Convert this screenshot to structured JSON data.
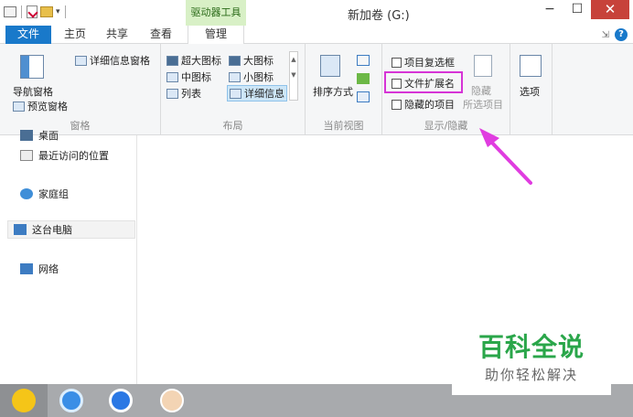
{
  "window": {
    "title": "新加卷 (G:)",
    "context_group_label": "驱动器工具",
    "minimize": "−",
    "maximize": "☐",
    "close": "✕"
  },
  "tabs": {
    "file": "文件",
    "home": "主页",
    "share": "共享",
    "view": "查看",
    "manage": "管理"
  },
  "ribbon": {
    "panes": {
      "nav_pane": "导航窗格",
      "preview_pane": "预览窗格",
      "details_pane": "详细信息窗格",
      "label": "窗格"
    },
    "layout": {
      "extra_large_icons": "超大图标",
      "large_icons": "大图标",
      "medium_icons": "中图标",
      "small_icons": "小图标",
      "list": "列表",
      "details": "详细信息",
      "label": "布局"
    },
    "current_view": {
      "sort_by": "排序方式",
      "label": "当前视图"
    },
    "show_hide": {
      "item_checkboxes": "项目复选框",
      "file_extensions": "文件扩展名",
      "hidden_items": "隐藏的项目",
      "hide_selected_line1": "隐藏",
      "hide_selected_line2": "所选项目",
      "label": "显示/隐藏"
    },
    "options": "选项"
  },
  "nav": {
    "partial_top": "桌面",
    "recent_places": "最近访问的位置",
    "homegroup": "家庭组",
    "this_pc": "这台电脑",
    "network": "网络"
  },
  "watermark": {
    "title": "百科全说",
    "subtitle": "助你轻松解决"
  },
  "colors": {
    "file_tab": "#1979ca",
    "context_group": "#d8f0c6",
    "highlight": "#d634d6",
    "arrow": "#e03ce0",
    "watermark_green": "#2aa64a"
  }
}
